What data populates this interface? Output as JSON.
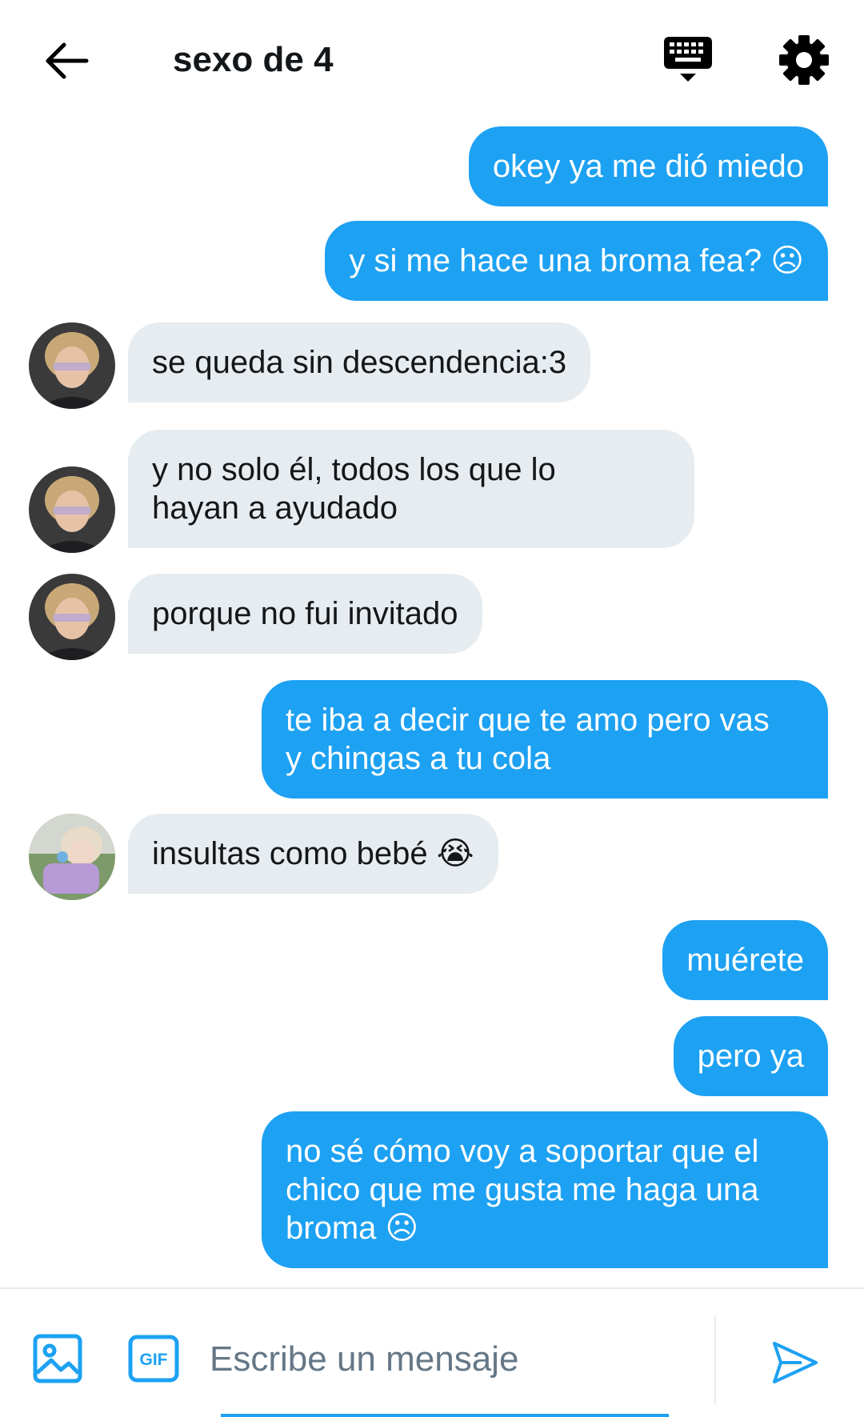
{
  "header": {
    "title": "sexo de 4"
  },
  "messages": [
    {
      "from": "me",
      "text": "okey ya me dió miedo"
    },
    {
      "from": "me",
      "text": "y si me hace una broma fea? ☹"
    },
    {
      "from": "other",
      "text": "se queda sin descendencia:3"
    },
    {
      "from": "other",
      "text": "y no solo él, todos los que lo\nhayan a ayudado"
    },
    {
      "from": "other",
      "text": "porque no fui invitado"
    },
    {
      "from": "me",
      "text": "te iba a decir que te amo pero vas\ny chingas a tu cola"
    },
    {
      "from": "other",
      "text": "insultas como bebé 😭"
    },
    {
      "from": "me",
      "text": "muérete"
    },
    {
      "from": "me",
      "text": "pero ya"
    },
    {
      "from": "me",
      "text": "no sé cómo voy a soportar que el\nchico que me gusta me haga una\nbroma ☹"
    }
  ],
  "composer": {
    "placeholder": "Escribe un mensaje",
    "gif_label": "GIF"
  },
  "icons": {
    "back": "arrow-left-icon",
    "keyboard": "keyboard-icon",
    "settings": "gear-icon",
    "media": "image-icon",
    "gif": "gif-icon",
    "send": "send-icon"
  },
  "colors": {
    "accent": "#1da1f2",
    "incoming_bubble": "#e6ecf0",
    "text": "#14171a",
    "placeholder": "#657786"
  }
}
